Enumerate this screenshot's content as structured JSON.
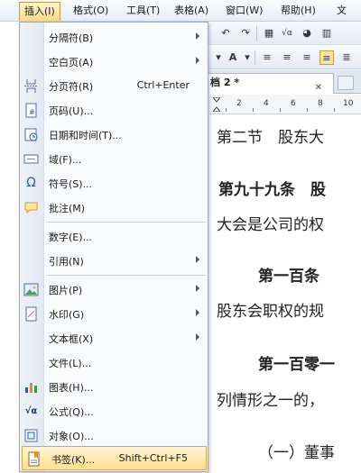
{
  "menubar": {
    "items": [
      {
        "label": "插入(I)",
        "active": true
      },
      {
        "label": "格式(O)"
      },
      {
        "label": "工具(T)"
      },
      {
        "label": "表格(A)"
      },
      {
        "label": "窗口(W)"
      },
      {
        "label": "帮助(H)"
      },
      {
        "label": "文"
      }
    ]
  },
  "insert_menu": {
    "items": [
      {
        "label": "分隔符(B)",
        "icon": "none",
        "submenu": true
      },
      {
        "label": "空白页(A)",
        "icon": "none",
        "submenu": true
      },
      {
        "label": "分页符(R)",
        "icon": "page-break-icon",
        "shortcut": "Ctrl+Enter"
      },
      {
        "label": "页码(U)...",
        "icon": "page-number-icon"
      },
      {
        "label": "日期和时间(T)...",
        "icon": "date-time-icon"
      },
      {
        "label": "域(F)...",
        "icon": "field-icon"
      },
      {
        "label": "符号(S)...",
        "icon": "omega-icon",
        "glyph": "Ω"
      },
      {
        "label": "批注(M)",
        "icon": "comment-icon"
      },
      {
        "label": "数字(E)...",
        "icon": "none"
      },
      {
        "label": "引用(N)",
        "icon": "none",
        "submenu": true
      },
      {
        "label": "图片(P)",
        "icon": "picture-icon",
        "submenu": true
      },
      {
        "label": "水印(G)",
        "icon": "watermark-icon",
        "submenu": true
      },
      {
        "label": "文本框(X)",
        "icon": "none",
        "submenu": true
      },
      {
        "label": "文件(L)...",
        "icon": "none"
      },
      {
        "label": "图表(H)...",
        "icon": "chart-icon"
      },
      {
        "label": "公式(Q)...",
        "icon": "formula-icon",
        "glyph": "√α"
      },
      {
        "label": "对象(O)...",
        "icon": "object-icon"
      },
      {
        "label": "书签(K)...",
        "icon": "bookmark-icon",
        "shortcut": "Shift+Ctrl+F5",
        "highlighted": true
      }
    ]
  },
  "document": {
    "tab_title": "档 2 *",
    "ruler_numbers": [
      "2",
      "4",
      "6",
      "8",
      "10"
    ],
    "lines": [
      "第二节　股东大",
      "第九十九条　股",
      "大会是公司的权",
      "第一百条",
      "股东会职权的规",
      "第一百零一",
      "列情形之一的，",
      "（一）董事"
    ]
  },
  "colors": {
    "highlight_top": "#fff4d2",
    "highlight_bottom": "#ffe08e",
    "menu_border": "#9aa7b9"
  }
}
